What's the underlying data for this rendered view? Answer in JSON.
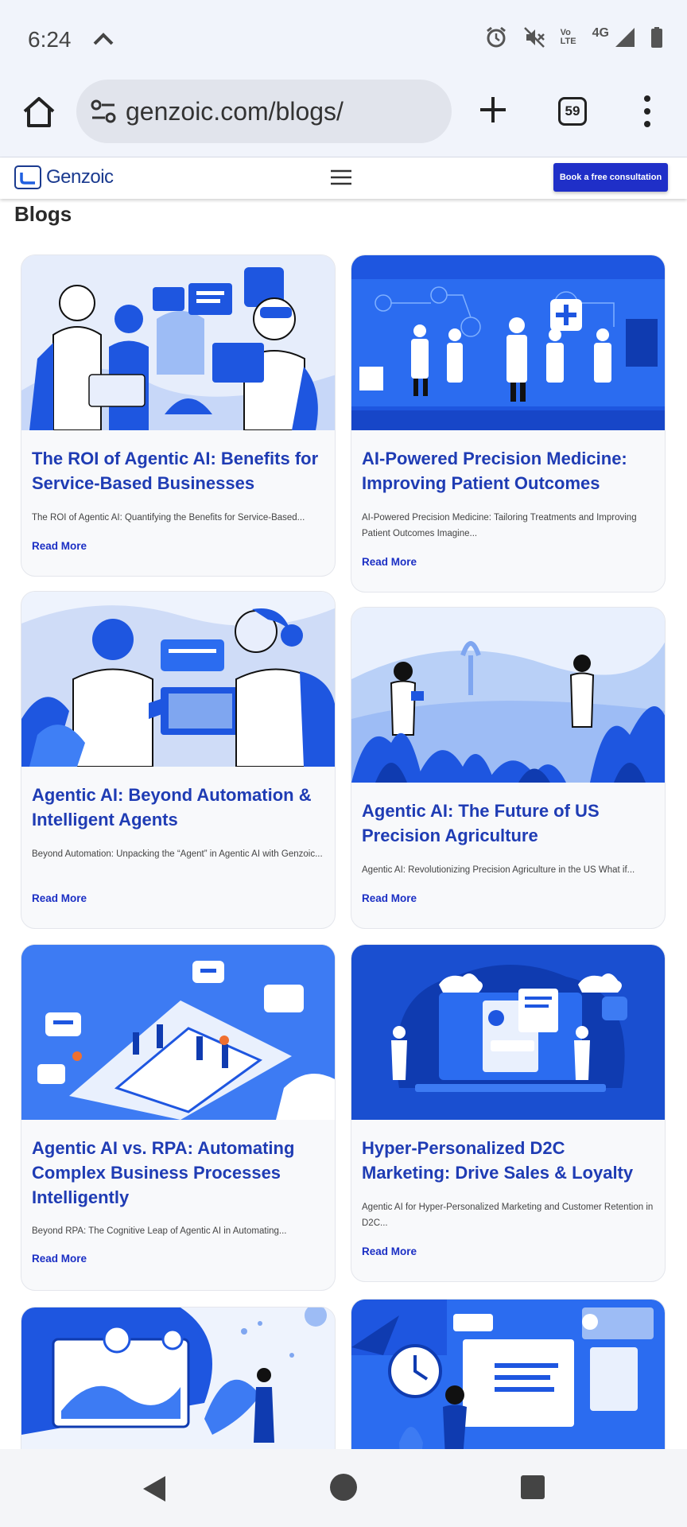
{
  "status_bar": {
    "time": "6:24",
    "icons": [
      "chevron-up-icon",
      "alarm-icon",
      "muted-icon",
      "volte-icon",
      "signal-4g-icon",
      "battery-icon"
    ],
    "volte_text": "Vo LTE",
    "network": "4G"
  },
  "browser": {
    "url": "genzoic.com/blogs/",
    "tab_count": "59"
  },
  "site_header": {
    "logo_text": "Genzoic",
    "cta_label": "Book a free consultation"
  },
  "page": {
    "title": "Blogs"
  },
  "cards": [
    {
      "title": "The ROI of Agentic AI: Benefits for Service-Based Businesses",
      "excerpt": "The ROI of Agentic AI: Quantifying the Benefits for Service-Based...",
      "link": "Read More"
    },
    {
      "title": "AI-Powered Precision Medicine: Improving Patient Outcomes",
      "excerpt": "AI-Powered Precision Medicine: Tailoring Treatments and Improving Patient Outcomes Imagine...",
      "link": "Read More"
    },
    {
      "title": "Agentic AI: Beyond Automation & Intelligent Agents",
      "excerpt": "Beyond Automation: Unpacking the “Agent” in Agentic AI with Genzoic...",
      "link": "Read More"
    },
    {
      "title": "Agentic AI: The Future of US Precision Agriculture",
      "excerpt": "Agentic AI: Revolutionizing Precision Agriculture in the US What if...",
      "link": "Read More"
    },
    {
      "title": "Agentic AI vs. RPA: Automating Complex Business Processes Intelligently",
      "excerpt": "Beyond RPA: The Cognitive Leap of Agentic AI in Automating...",
      "link": "Read More"
    },
    {
      "title": "Hyper-Personalized D2C Marketing: Drive Sales & Loyalty",
      "excerpt": "Agentic AI for Hyper-Personalized Marketing and Customer Retention in D2C...",
      "link": "Read More"
    }
  ],
  "colors": {
    "accent": "#1f3cb4",
    "cta": "#1f2fc8",
    "illustration_blue": "#1e56e0"
  }
}
